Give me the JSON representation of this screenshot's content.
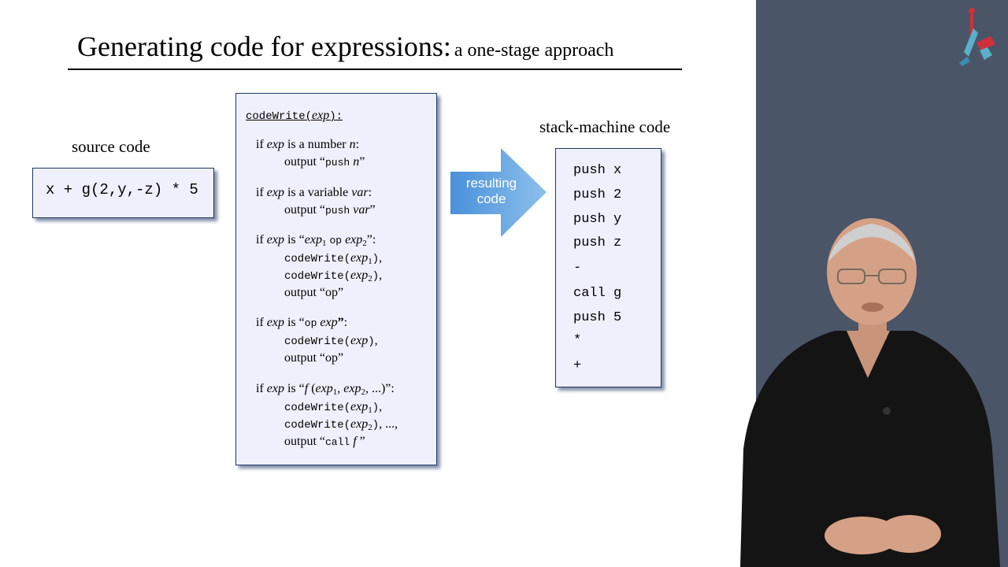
{
  "title": {
    "main": "Generating code for expressions:",
    "sub": "a one-stage approach"
  },
  "source": {
    "label": "source code",
    "code": "x + g(2,y,-z) * 5"
  },
  "algorithm": {
    "header_fn": "codeWrite(",
    "header_arg": "exp",
    "header_tail": "):",
    "word_if": "if",
    "word_exp": "exp",
    "word_is": "is",
    "word_output": "output",
    "word_op": "op",
    "fn_codewrite": "codeWrite",
    "colon": ":",
    "case1_rest": "is a number",
    "case1_var": "n",
    "case1_out_kw": "push",
    "case1_out_var": "n",
    "case2_rest": "is a variable",
    "case2_var": "var",
    "case2_out_kw": "push",
    "case2_out_var": "var",
    "sub_1": "1",
    "sub_2": "2",
    "case5_f": "f",
    "ellipsis": "...",
    "call_kw": "call"
  },
  "arrow": {
    "line1": "resulting",
    "line2": "code",
    "color": "#4a90d9"
  },
  "stack": {
    "label": "stack-machine code",
    "lines": [
      "push x",
      "push 2",
      "push y",
      "push z",
      "-",
      "call g",
      "push 5",
      "*",
      "+"
    ]
  },
  "colors": {
    "box_fill": "#f0f0fc",
    "box_border": "#1f3763",
    "side_panel": "#4a5567"
  },
  "icons": {
    "logo": "nand2tetris-logo",
    "presenter": "presenter-video"
  }
}
